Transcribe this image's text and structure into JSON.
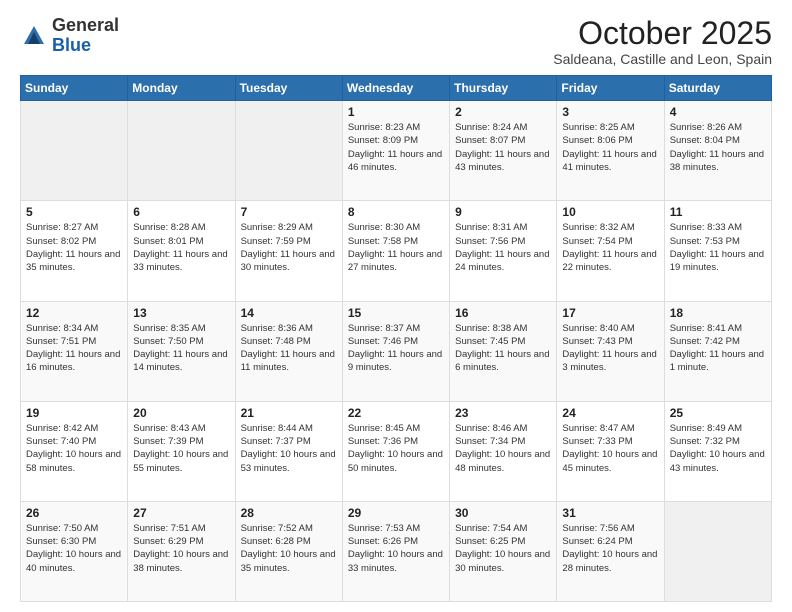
{
  "header": {
    "logo": {
      "general": "General",
      "blue": "Blue"
    },
    "month": "October 2025",
    "location": "Saldeana, Castille and Leon, Spain"
  },
  "weekdays": [
    "Sunday",
    "Monday",
    "Tuesday",
    "Wednesday",
    "Thursday",
    "Friday",
    "Saturday"
  ],
  "weeks": [
    [
      {
        "day": "",
        "info": ""
      },
      {
        "day": "",
        "info": ""
      },
      {
        "day": "",
        "info": ""
      },
      {
        "day": "1",
        "info": "Sunrise: 8:23 AM\nSunset: 8:09 PM\nDaylight: 11 hours\nand 46 minutes."
      },
      {
        "day": "2",
        "info": "Sunrise: 8:24 AM\nSunset: 8:07 PM\nDaylight: 11 hours\nand 43 minutes."
      },
      {
        "day": "3",
        "info": "Sunrise: 8:25 AM\nSunset: 8:06 PM\nDaylight: 11 hours\nand 41 minutes."
      },
      {
        "day": "4",
        "info": "Sunrise: 8:26 AM\nSunset: 8:04 PM\nDaylight: 11 hours\nand 38 minutes."
      }
    ],
    [
      {
        "day": "5",
        "info": "Sunrise: 8:27 AM\nSunset: 8:02 PM\nDaylight: 11 hours\nand 35 minutes."
      },
      {
        "day": "6",
        "info": "Sunrise: 8:28 AM\nSunset: 8:01 PM\nDaylight: 11 hours\nand 33 minutes."
      },
      {
        "day": "7",
        "info": "Sunrise: 8:29 AM\nSunset: 7:59 PM\nDaylight: 11 hours\nand 30 minutes."
      },
      {
        "day": "8",
        "info": "Sunrise: 8:30 AM\nSunset: 7:58 PM\nDaylight: 11 hours\nand 27 minutes."
      },
      {
        "day": "9",
        "info": "Sunrise: 8:31 AM\nSunset: 7:56 PM\nDaylight: 11 hours\nand 24 minutes."
      },
      {
        "day": "10",
        "info": "Sunrise: 8:32 AM\nSunset: 7:54 PM\nDaylight: 11 hours\nand 22 minutes."
      },
      {
        "day": "11",
        "info": "Sunrise: 8:33 AM\nSunset: 7:53 PM\nDaylight: 11 hours\nand 19 minutes."
      }
    ],
    [
      {
        "day": "12",
        "info": "Sunrise: 8:34 AM\nSunset: 7:51 PM\nDaylight: 11 hours\nand 16 minutes."
      },
      {
        "day": "13",
        "info": "Sunrise: 8:35 AM\nSunset: 7:50 PM\nDaylight: 11 hours\nand 14 minutes."
      },
      {
        "day": "14",
        "info": "Sunrise: 8:36 AM\nSunset: 7:48 PM\nDaylight: 11 hours\nand 11 minutes."
      },
      {
        "day": "15",
        "info": "Sunrise: 8:37 AM\nSunset: 7:46 PM\nDaylight: 11 hours\nand 9 minutes."
      },
      {
        "day": "16",
        "info": "Sunrise: 8:38 AM\nSunset: 7:45 PM\nDaylight: 11 hours\nand 6 minutes."
      },
      {
        "day": "17",
        "info": "Sunrise: 8:40 AM\nSunset: 7:43 PM\nDaylight: 11 hours\nand 3 minutes."
      },
      {
        "day": "18",
        "info": "Sunrise: 8:41 AM\nSunset: 7:42 PM\nDaylight: 11 hours\nand 1 minute."
      }
    ],
    [
      {
        "day": "19",
        "info": "Sunrise: 8:42 AM\nSunset: 7:40 PM\nDaylight: 10 hours\nand 58 minutes."
      },
      {
        "day": "20",
        "info": "Sunrise: 8:43 AM\nSunset: 7:39 PM\nDaylight: 10 hours\nand 55 minutes."
      },
      {
        "day": "21",
        "info": "Sunrise: 8:44 AM\nSunset: 7:37 PM\nDaylight: 10 hours\nand 53 minutes."
      },
      {
        "day": "22",
        "info": "Sunrise: 8:45 AM\nSunset: 7:36 PM\nDaylight: 10 hours\nand 50 minutes."
      },
      {
        "day": "23",
        "info": "Sunrise: 8:46 AM\nSunset: 7:34 PM\nDaylight: 10 hours\nand 48 minutes."
      },
      {
        "day": "24",
        "info": "Sunrise: 8:47 AM\nSunset: 7:33 PM\nDaylight: 10 hours\nand 45 minutes."
      },
      {
        "day": "25",
        "info": "Sunrise: 8:49 AM\nSunset: 7:32 PM\nDaylight: 10 hours\nand 43 minutes."
      }
    ],
    [
      {
        "day": "26",
        "info": "Sunrise: 7:50 AM\nSunset: 6:30 PM\nDaylight: 10 hours\nand 40 minutes."
      },
      {
        "day": "27",
        "info": "Sunrise: 7:51 AM\nSunset: 6:29 PM\nDaylight: 10 hours\nand 38 minutes."
      },
      {
        "day": "28",
        "info": "Sunrise: 7:52 AM\nSunset: 6:28 PM\nDaylight: 10 hours\nand 35 minutes."
      },
      {
        "day": "29",
        "info": "Sunrise: 7:53 AM\nSunset: 6:26 PM\nDaylight: 10 hours\nand 33 minutes."
      },
      {
        "day": "30",
        "info": "Sunrise: 7:54 AM\nSunset: 6:25 PM\nDaylight: 10 hours\nand 30 minutes."
      },
      {
        "day": "31",
        "info": "Sunrise: 7:56 AM\nSunset: 6:24 PM\nDaylight: 10 hours\nand 28 minutes."
      },
      {
        "day": "",
        "info": ""
      }
    ]
  ]
}
